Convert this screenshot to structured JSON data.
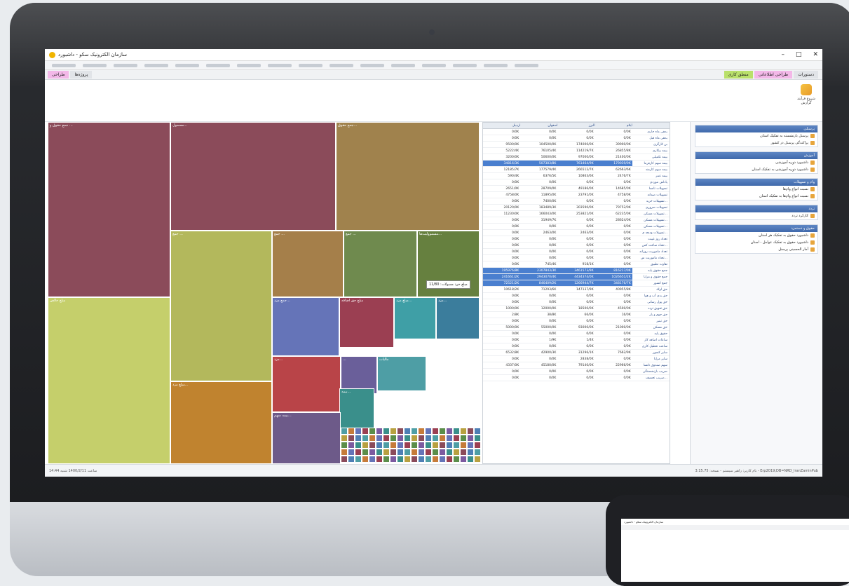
{
  "app": {
    "title": "سازمان الکترونیک سکو - داشبورد"
  },
  "window": {
    "minimize": "–",
    "maximize": "□",
    "close": "✕"
  },
  "quick_toolbar": [
    "",
    "",
    "",
    "",
    "",
    "",
    "",
    "",
    "",
    "",
    "",
    "",
    "",
    "",
    "",
    ""
  ],
  "tabs": [
    {
      "label": "طراحی",
      "style": "pink"
    },
    {
      "label": "پروژه‌ها",
      "style": "plain"
    }
  ],
  "right_tabs": [
    {
      "label": "دستورات",
      "style": "plain"
    },
    {
      "label": "طراحی اطلاعاتی",
      "style": "pink"
    },
    {
      "label": "منطق کاری",
      "style": "green"
    }
  ],
  "ribbon": {
    "button_label": "شروع فرآیند گزارش"
  },
  "treemap_cells": [
    {
      "label": "جمع حقوق و ...",
      "color": "#8b4b5a"
    },
    {
      "label": "مسمول...",
      "color": "#8b4b5a"
    },
    {
      "label": "جمع حقوق...",
      "color": "#a0824d"
    },
    {
      "label": "جمع ...",
      "color": "#b3b85c"
    },
    {
      "label": "جمع ...",
      "color": "#a57f4a"
    },
    {
      "label": "جمع ...",
      "color": "#6f8a4e"
    },
    {
      "label": "مسموولیت‌ها...",
      "color": "#66803f"
    },
    {
      "label": "مبلغ خالص",
      "color": "#c5cf6b"
    },
    {
      "label": "جمع مزد...",
      "color": "#6574b8"
    },
    {
      "label": "مبلغ حق اضافه",
      "color": "#9b3f52"
    },
    {
      "label": "مبلغ مزد...",
      "color": "#3f9fa6"
    },
    {
      "label": "مزد...",
      "color": "#3b7d9c"
    },
    {
      "label": "مبلغ مزد...",
      "color": "#c0832f"
    },
    {
      "label": "مزد...",
      "color": "#b94448"
    },
    {
      "label": "...",
      "color": "#6a5f9a"
    },
    {
      "label": "بیمه...",
      "color": "#3a8f8b"
    },
    {
      "label": "مالیات",
      "color": "#4e9ea5"
    },
    {
      "label": "بیمه سهم...",
      "color": "#6d5a89"
    }
  ],
  "tooltip": "مبلغ خرد مسولات: 11/80",
  "grid": {
    "headers": [
      "اردیبل",
      "اسفهان",
      "البرز",
      "ایلام"
    ],
    "rows": [
      {
        "label": "بدهی ماه جاری",
        "v": [
          "0/0K",
          "0/0K",
          "0/0K",
          "0/0K"
        ]
      },
      {
        "label": "بدهی ماه قبل",
        "v": [
          "0/0K",
          "0/0K",
          "0/0K",
          "0/0K"
        ]
      },
      {
        "label": "بن کارگری",
        "v": [
          "39900/0K",
          "174000/0K",
          "104500/0K",
          "9500/0K"
        ]
      },
      {
        "label": "بیمه بیکاری",
        "v": [
          "26855/8K",
          "114219/7K",
          "76105/4K",
          "5222/4K"
        ]
      },
      {
        "label": "بیمه تکمیلی",
        "v": [
          "21400/0K",
          "97000/0K",
          "50600/0K",
          "3200/0K"
        ]
      },
      {
        "label": "بیمه سهم کارفرما",
        "v": [
          "179039/0K",
          "761464/9K",
          "507383/8K",
          "34816/3K"
        ]
      },
      {
        "label": "بیمه سهم کارمند",
        "v": [
          "62663/6K",
          "266512/7K",
          "177579/4K",
          "12185/7K"
        ]
      },
      {
        "label": "بیمه عمر",
        "v": [
          "2476/7K",
          "10863/6K",
          "6376/5K",
          "590/4K"
        ]
      },
      {
        "label": "پاداش موردی",
        "v": [
          "0/0K",
          "0/0K",
          "0/0K",
          "0/0K"
        ]
      },
      {
        "label": "تسهیلات تانسا",
        "v": [
          "14685/0K",
          "49186/0K",
          "28709/0K",
          "2651/0K"
        ]
      },
      {
        "label": "تسهیلات ضمانه",
        "v": [
          "4758/0K",
          "23791/0K",
          "11895/0K",
          "4758/0K"
        ]
      },
      {
        "label": "تسهیلات خرید...",
        "v": [
          "0/0K",
          "0/0K",
          "7400/0K",
          "0/0K"
        ]
      },
      {
        "label": "تسهیلات ضروری",
        "v": [
          "79752/0K",
          "303590/0K",
          "183489/3K",
          "20120/0K"
        ]
      },
      {
        "label": "تسهیلات مسکن...",
        "v": [
          "62235/0K",
          "253821/0K",
          "166043/0K",
          "11230/0K"
        ]
      },
      {
        "label": "تسهیلات مسکن...",
        "v": [
          "28624/0K",
          "0/0K",
          "31949/7K",
          "0/0K"
        ]
      },
      {
        "label": "تسهیلات مسکن...",
        "v": [
          "0/0K",
          "0/0K",
          "0/0K",
          "0/0K"
        ]
      },
      {
        "label": "تسهیلات ودیعه م...",
        "v": [
          "0/0K",
          "2463/0K",
          "2463/0K",
          "0/0K"
        ]
      },
      {
        "label": "تعداد روز غیبت",
        "v": [
          "0/0K",
          "0/0K",
          "0/0K",
          "0/0K"
        ]
      },
      {
        "label": "تعداد ساعت کس...",
        "v": [
          "0/0K",
          "0/0K",
          "0/0K",
          "0/0K"
        ]
      },
      {
        "label": "تعداد ماموریت روزانه",
        "v": [
          "0/0K",
          "0/0K",
          "0/0K",
          "0/0K"
        ]
      },
      {
        "label": "تعداد ماموریت س...",
        "v": [
          "0/0K",
          "0/0K",
          "0/0K",
          "0/0K"
        ]
      },
      {
        "label": "تفاوت تطبیق",
        "v": [
          "0/0K",
          "918/1K",
          "745/4K",
          "0/0K"
        ]
      },
      {
        "label": "جمع حقوق پایه",
        "v": [
          "816217/0K",
          "3461573/9K",
          "2307843/3K",
          "195976/8K"
        ]
      },
      {
        "label": "جمع حقوق و مزایا",
        "v": [
          "1026651/2K",
          "4434374/0K",
          "2943070/4K",
          "241661/2K"
        ]
      },
      {
        "label": "جمع کسور",
        "v": [
          "348176/7K",
          "1266944/7K",
          "846409/2K",
          "72521/2K"
        ]
      },
      {
        "label": "حق اولاد",
        "v": [
          "40955/8K",
          "147137/9K",
          "71293/6K",
          "10618/2K"
        ]
      },
      {
        "label": "حق بدی آب و هوا",
        "v": [
          "0/0K",
          "0/0K",
          "0/0K",
          "0/0K"
        ]
      },
      {
        "label": "حق پول رسانی",
        "v": [
          "0/0K",
          "0/0K",
          "0/0K",
          "0/0K"
        ]
      },
      {
        "label": "حق تعویق تردد",
        "v": [
          "4500/0K",
          "18500/0K",
          "12000/0K",
          "1000/0K"
        ]
      },
      {
        "label": "حق جوم و بار",
        "v": [
          "16/0K",
          "66/0K",
          "38/8K",
          "2/8K"
        ]
      },
      {
        "label": "حق تبنیر",
        "v": [
          "0/0K",
          "0/0K",
          "0/0K",
          "0/0K"
        ]
      },
      {
        "label": "حق مسکن",
        "v": [
          "21000/0K",
          "93000/0K",
          "55000/0K",
          "5000/0K"
        ]
      },
      {
        "label": "حقوق پایه",
        "v": [
          "0/0K",
          "0/0K",
          "0/0K",
          "0/0K"
        ]
      },
      {
        "label": "ساعات اضافه کار",
        "v": [
          "0/0K",
          "1/4K",
          "1/9K",
          "0/0K"
        ]
      },
      {
        "label": "ساعت تعطیل کاری",
        "v": [
          "0/0K",
          "0/0K",
          "0/0K",
          "0/0K"
        ]
      },
      {
        "label": "سایر کسور",
        "v": [
          "7662/9K",
          "31296/1K",
          "42900/3K",
          "6532/8K"
        ]
      },
      {
        "label": "سایر مزایا",
        "v": [
          "0/0K",
          "2838/0K",
          "0/0K",
          "0/0K"
        ]
      },
      {
        "label": "سهم صندوق تانسا",
        "v": [
          "22966/0K",
          "79140/0K",
          "45180/0K",
          "4337/0K"
        ]
      },
      {
        "label": "ضریب بازنشستگی",
        "v": [
          "0/0K",
          "0/0K",
          "0/0K",
          "0/0K"
        ]
      },
      {
        "label": "ضریب تعسیف...",
        "v": [
          "0/0K",
          "0/0K",
          "0/0K",
          "0/0K"
        ]
      }
    ],
    "highlighted_rows": [
      5,
      22,
      23,
      24
    ]
  },
  "side_panel": {
    "groups": [
      {
        "title": "پرسنلی",
        "items": [
          "پرسنل بازنشسته به تفکیک استان",
          "پراکندگی پرسنل در کشور"
        ]
      },
      {
        "title": "آموزش",
        "items": [
          "داشبورد دوره آموزشی",
          "داشبورد دوره آموزشی به تفکیک استان"
        ]
      },
      {
        "title": "وام و تسهیلات",
        "items": [
          "نسبت انواع وام‌ها",
          "نسبت انواع وام‌ها به تفکیک استان"
        ]
      },
      {
        "title": "تردد",
        "items": [
          "کارکرد تردد"
        ]
      },
      {
        "title": "حقوق و دستمزد",
        "items": [
          "داشبورد حقوق به تفکیک هر استان",
          "داشبورد حقوق به تفکیک عوامل - استان",
          "آمار الحسینی پرسنل"
        ]
      }
    ]
  },
  "statusbar": {
    "left": "14:44 ساعت 1400/2/11 شنبه",
    "right": "نام کاربر: راهبر سیستم - نسخه: 3.15.75 - Erp2019;DB=NRD_IranZaminPub"
  },
  "mini_screen": {
    "title": "سازمان الکترونیک سکو - داشبورد"
  }
}
